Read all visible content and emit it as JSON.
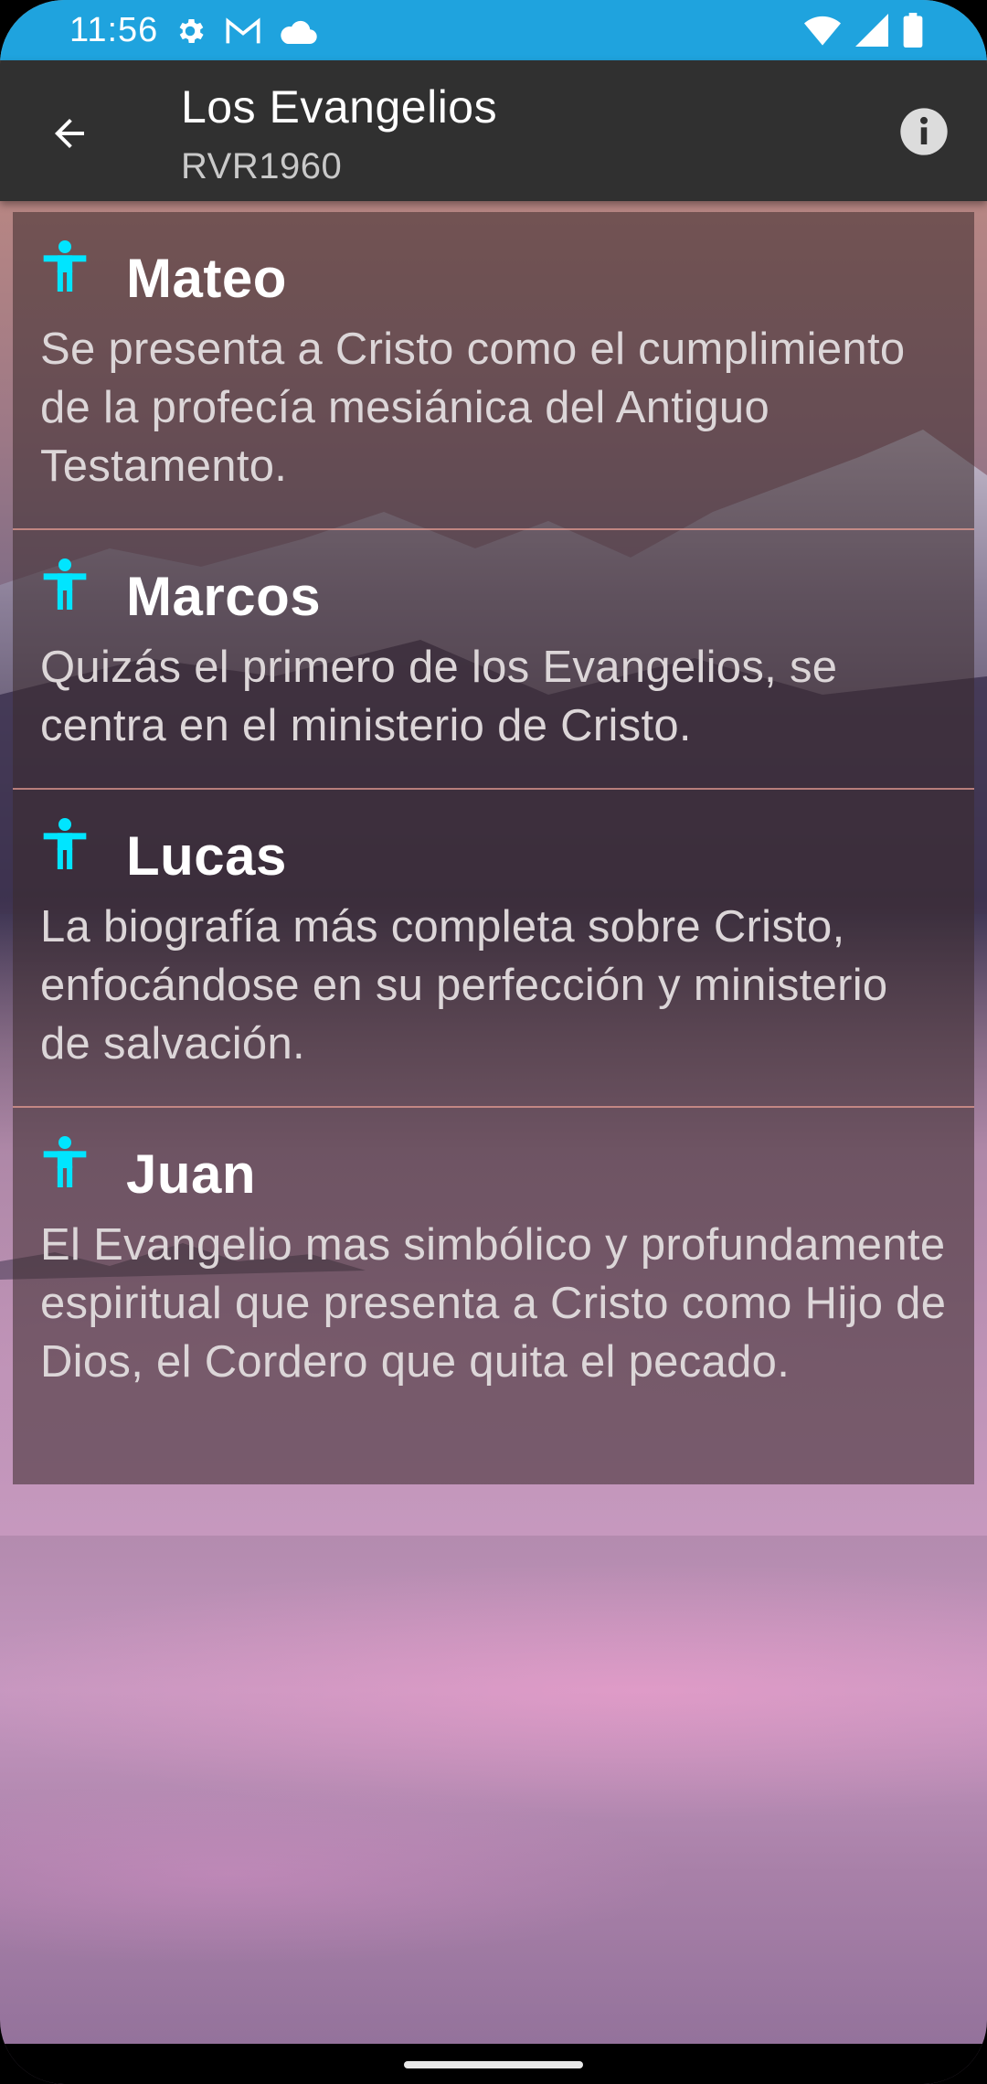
{
  "status_bar": {
    "time": "11:56",
    "left_icons": [
      "gear-icon",
      "gmail-icon",
      "cloud-icon"
    ],
    "right_icons": [
      "wifi-icon",
      "signal-icon",
      "battery-icon"
    ],
    "color": "#1fa3de"
  },
  "app_bar": {
    "title": "Los Evangelios",
    "subtitle": "RVR1960",
    "back_icon": "arrow-left-icon",
    "info_icon": "info-icon"
  },
  "books": [
    {
      "title": "Mateo",
      "description": "Se presenta a Cristo como el cumplimiento de la profecía mesiánica del Antiguo Testamento.",
      "icon": "person-icon"
    },
    {
      "title": "Marcos",
      "description": "Quizás el primero de los Evangelios, se centra en el ministerio de Cristo.",
      "icon": "person-icon"
    },
    {
      "title": "Lucas",
      "description": "La biografía más completa sobre Cristo, enfocándose en su perfección y ministerio de salvación.",
      "icon": "person-icon"
    },
    {
      "title": "Juan",
      "description": "El Evangelio mas simbólico y profundamente espiritual que presenta a Cristo como Hijo de Dios, el Cordero que quita el pecado.",
      "icon": "person-icon"
    }
  ],
  "colors": {
    "accent_icon": "#00e5ff",
    "app_bar": "#303030"
  }
}
